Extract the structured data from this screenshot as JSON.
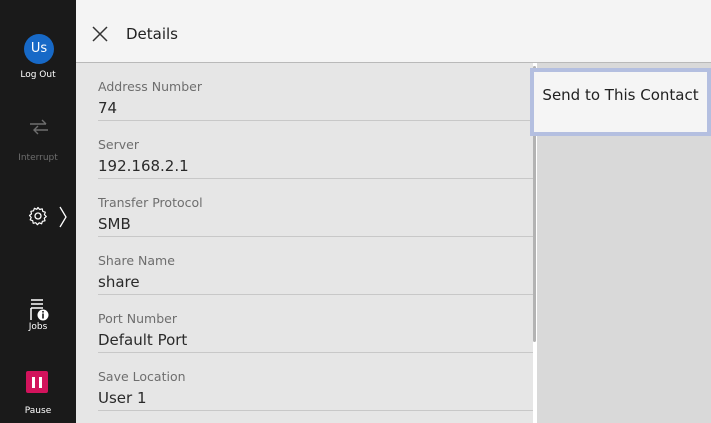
{
  "sidebar": {
    "avatar_initials": "Us",
    "logout_label": "Log Out",
    "interrupt_label": "Interrupt",
    "jobs_label": "Jobs",
    "pause_label": "Pause",
    "settings_icon": "gear-icon",
    "pause_color": "#d2135c"
  },
  "header": {
    "title": "Details",
    "close_icon": "close-icon"
  },
  "details": [
    {
      "label": "Address Number",
      "value": "74"
    },
    {
      "label": "Server",
      "value": "192.168.2.1"
    },
    {
      "label": "Transfer Protocol",
      "value": "SMB"
    },
    {
      "label": "Share Name",
      "value": "share"
    },
    {
      "label": "Port Number",
      "value": "Default Port"
    },
    {
      "label": "Save Location",
      "value": "User 1"
    }
  ],
  "actions": {
    "send_label": "Send to This Contact"
  }
}
